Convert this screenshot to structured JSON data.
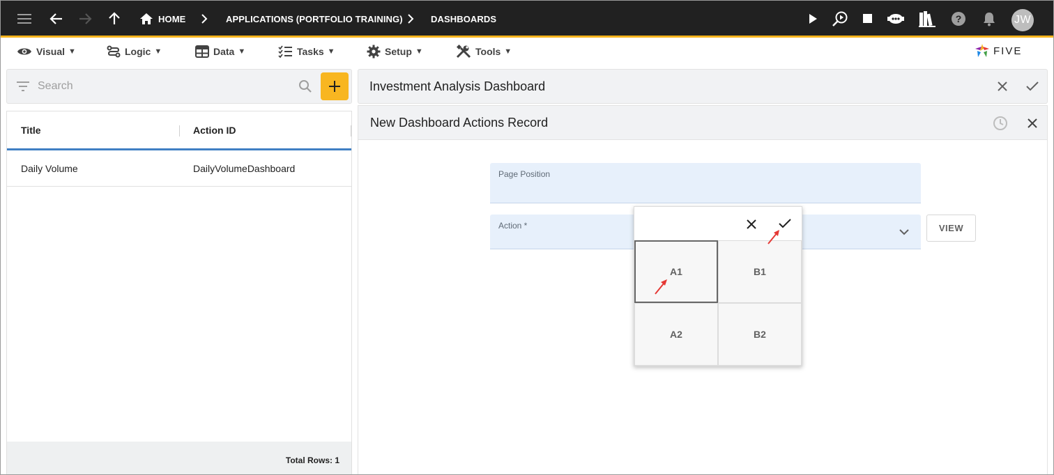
{
  "topbar": {
    "crumbs": [
      "HOME",
      "APPLICATIONS (PORTFOLIO TRAINING)",
      "DASHBOARDS"
    ],
    "avatar_initials": "JW",
    "accent": "#f5b31c"
  },
  "menu": {
    "items": [
      "Visual",
      "Logic",
      "Data",
      "Tasks",
      "Setup",
      "Tools"
    ],
    "caret": "▼",
    "logo_text": "FIVE"
  },
  "left": {
    "search_placeholder": "Search",
    "columns": [
      "Title",
      "Action ID"
    ],
    "rows": [
      {
        "title": "Daily Volume",
        "action_id": "DailyVolumeDashboard"
      }
    ],
    "total_rows": "Total Rows: 1"
  },
  "right": {
    "panel_title": "Investment Analysis Dashboard",
    "form_title": "New Dashboard Actions Record",
    "page_position_label": "Page Position",
    "action_label": "Action *",
    "view_button": "VIEW"
  },
  "grid": {
    "cells": [
      "A1",
      "B1",
      "A2",
      "B2"
    ],
    "selected": "A1"
  }
}
